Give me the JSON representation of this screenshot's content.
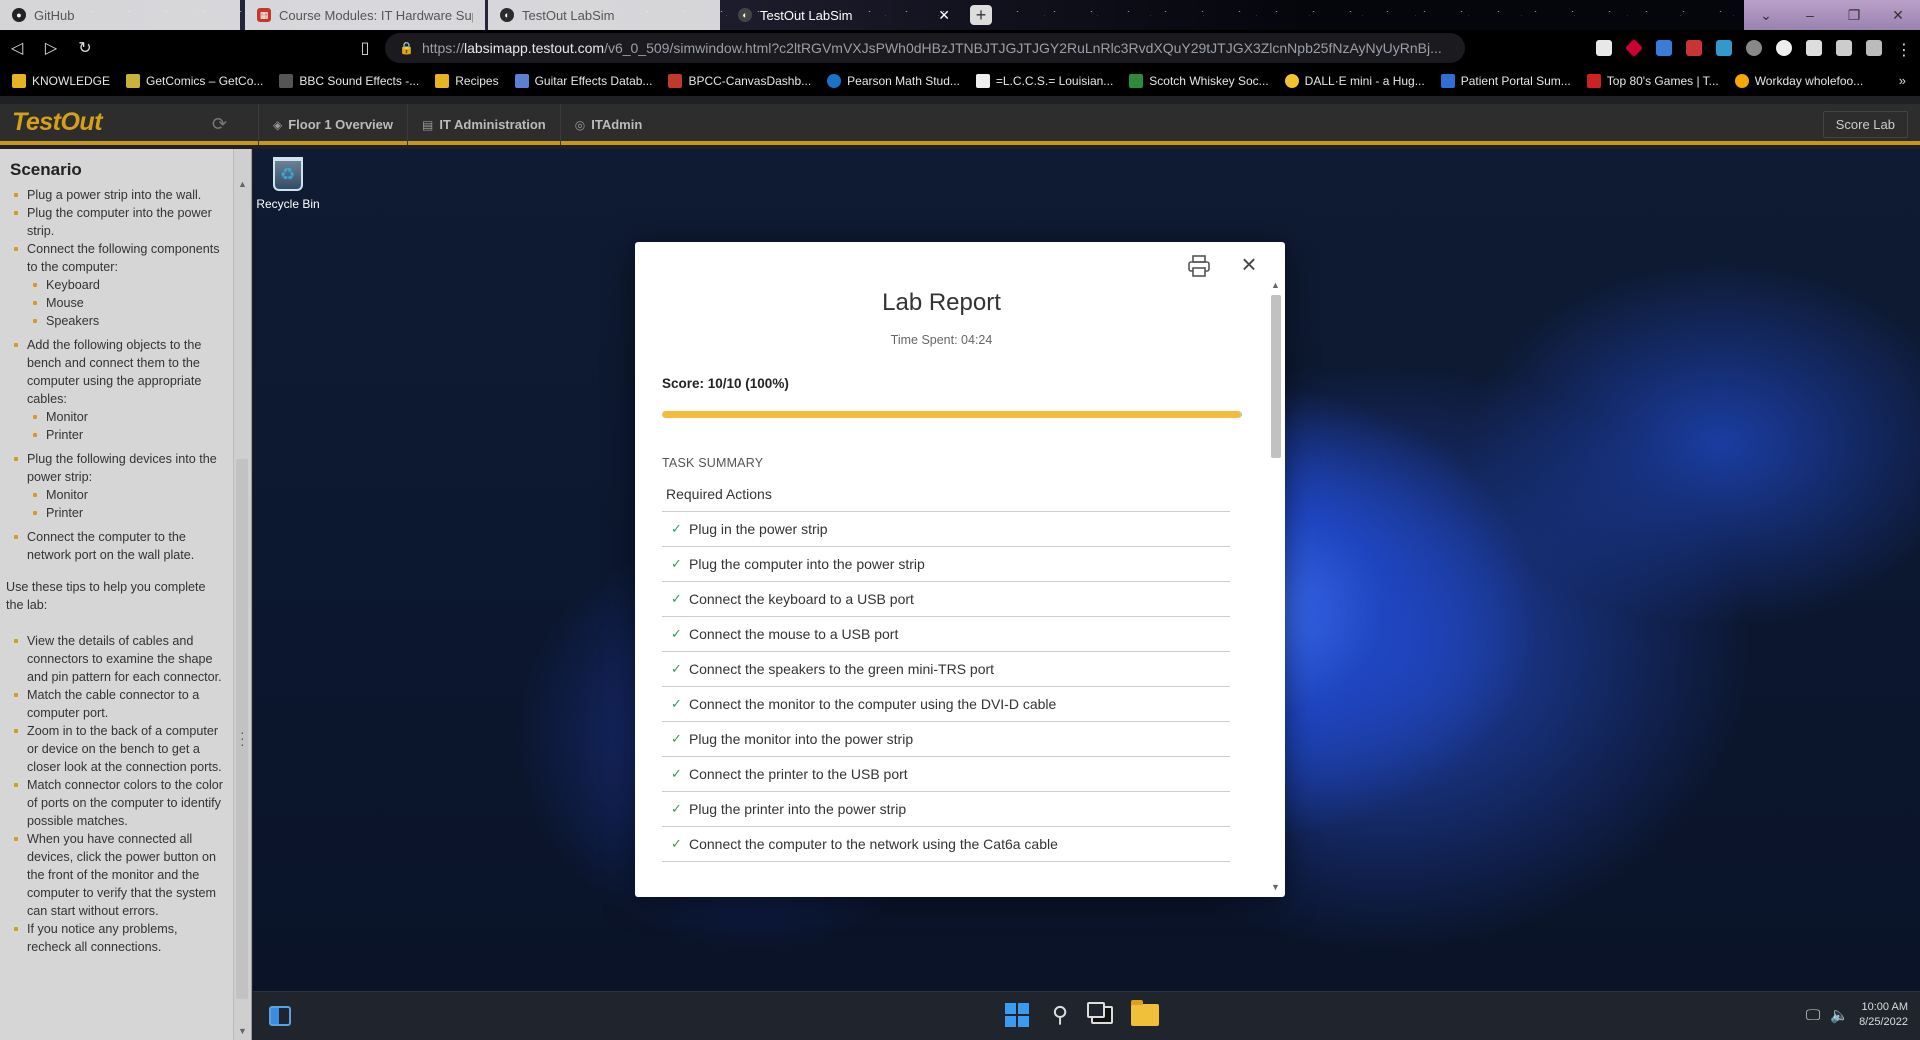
{
  "browser": {
    "tabs": [
      {
        "title": "GitHub",
        "active": false
      },
      {
        "title": "Course Modules: IT Hardware Suppor",
        "active": false
      },
      {
        "title": "TestOut LabSim",
        "active": false
      },
      {
        "title": "TestOut LabSim",
        "active": true
      }
    ],
    "url_scheme": "https://",
    "url_host": "labsimapp.testout.com",
    "url_path": "/v6_0_509/simwindow.html?c2ltRGVmVXJsPWh0dHBzJTNBJTJGJTJGY2RuLnRlc3RvdXQuY29tJTJGX3ZlcnNpb25fNzAyNyUyRnBj...",
    "bookmarks": [
      "KNOWLEDGE",
      "GetComics – GetCo...",
      "BBC Sound Effects -...",
      "Recipes",
      "Guitar Effects Datab...",
      "BPCC-CanvasDashb...",
      "Pearson Math Stud...",
      "=L.C.C.S.= Louisian...",
      "Scotch Whiskey Soc...",
      "DALL·E mini - a Hug...",
      "Patient Portal Sum...",
      "Top 80's Games | T...",
      "Workday wholefoo..."
    ]
  },
  "app": {
    "logo": "TestOut",
    "breadcrumbs": [
      "Floor 1 Overview",
      "IT Administration",
      "ITAdmin"
    ],
    "score_lab_label": "Score Lab"
  },
  "scenario": {
    "title": "Scenario",
    "tips_intro": "Use these tips to help you complete the lab:"
  },
  "desktop": {
    "recycle_bin_label": "Recycle Bin",
    "clock_time": "10:00 AM",
    "clock_date": "8/25/2022"
  },
  "report": {
    "title": "Lab Report",
    "time_spent": "Time Spent: 04:24",
    "score": "Score: 10/10 (100%)",
    "score_fraction": 1.0,
    "task_summary_label": "TASK SUMMARY",
    "required_actions_label": "Required Actions"
  },
  "colors": {
    "accent": "#d4a017",
    "progress_fill": "#f5bb3a",
    "check": "#2e9a5a"
  }
}
